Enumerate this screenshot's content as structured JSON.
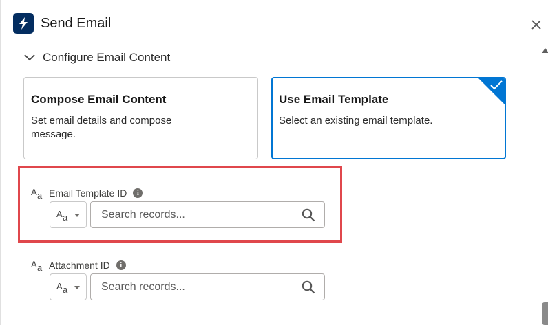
{
  "header": {
    "title": "Send Email"
  },
  "section": {
    "label": "Configure Email Content"
  },
  "cards": [
    {
      "title": "Compose Email Content",
      "description": "Set email details and compose message."
    },
    {
      "title": "Use Email Template",
      "description": "Select an existing email template."
    }
  ],
  "selected_card": "Use Email Template",
  "fields": [
    {
      "type_icon_big": "A",
      "type_icon_small": "a",
      "label": "Email Template ID",
      "info": "i",
      "selector_big": "A",
      "selector_small": "a",
      "placeholder": "Search records..."
    },
    {
      "type_icon_big": "A",
      "type_icon_small": "a",
      "label": "Attachment ID",
      "info": "i",
      "selector_big": "A",
      "selector_small": "a",
      "placeholder": "Search records..."
    }
  ],
  "colors": {
    "brand": "#032d60",
    "accent": "#0176d3",
    "highlight": "#e0474c"
  }
}
